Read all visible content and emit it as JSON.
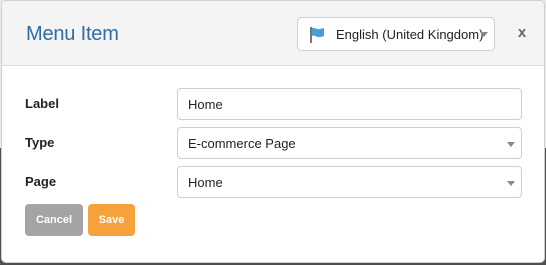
{
  "modal": {
    "title": "Menu Item",
    "close_label": "x"
  },
  "language_select": {
    "selected": "English (United Kingdom)",
    "icon": "flag-icon",
    "flag_color": "#4a9ed8"
  },
  "form": {
    "label": {
      "label": "Label",
      "value": "Home"
    },
    "type": {
      "label": "Type",
      "selected": "E-commerce Page"
    },
    "page": {
      "label": "Page",
      "selected": "Home"
    }
  },
  "buttons": {
    "cancel_label": "Cancel",
    "save_label": "Save",
    "cancel_color": "#a4a4a4",
    "save_color": "#f5a23b"
  },
  "colors": {
    "title": "#2f6da3",
    "header_bg": "#f4f4f4"
  }
}
